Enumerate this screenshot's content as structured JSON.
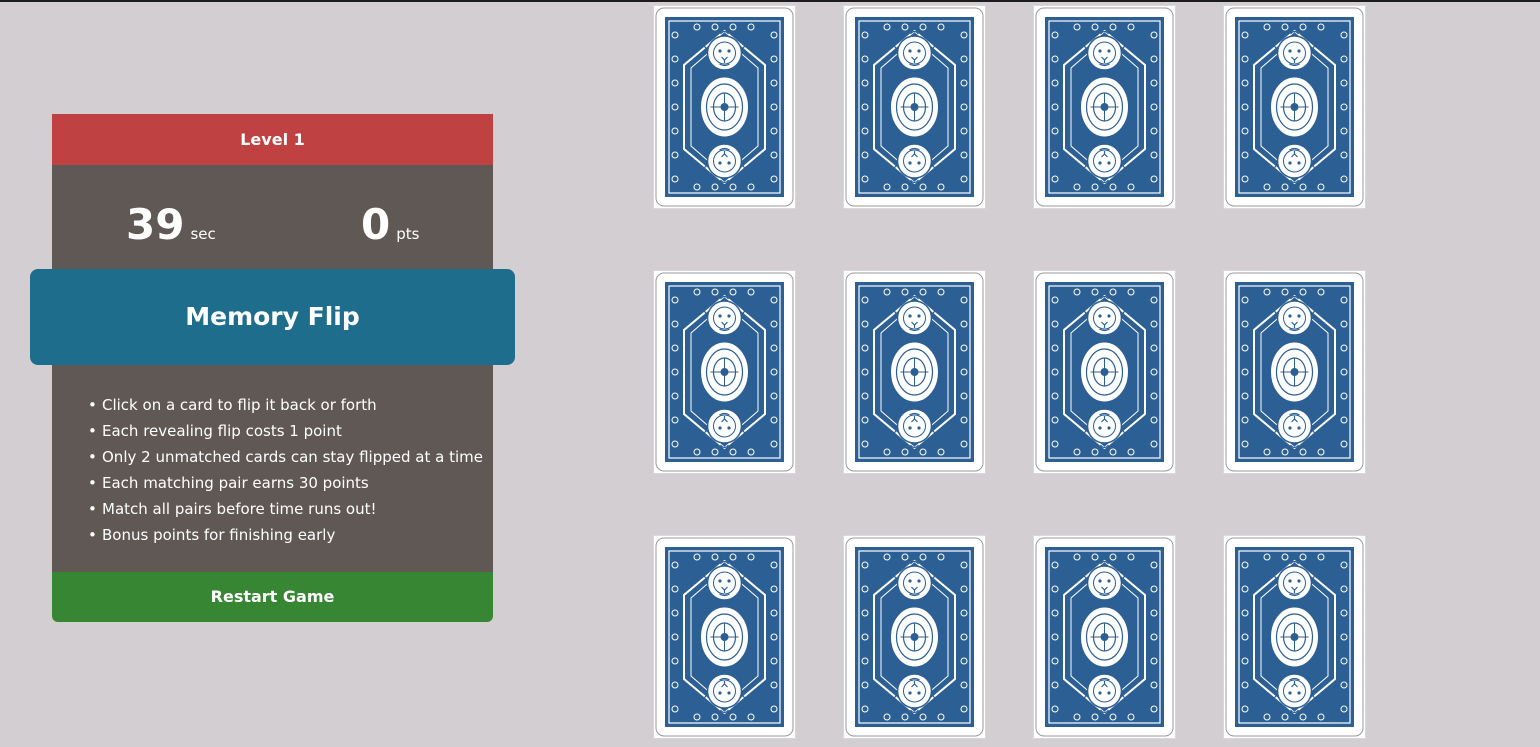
{
  "level_label": "Level 1",
  "stats": {
    "time_value": "39",
    "time_unit": "sec",
    "score_value": "0",
    "score_unit": "pts"
  },
  "title": "Memory Flip",
  "rules": [
    "Click on a card to flip it back or forth",
    "Each revealing flip costs 1 point",
    "Only 2 unmatched cards can stay flipped at a time",
    "Each matching pair earns 30 points",
    "Match all pairs before time runs out!",
    "Bonus points for finishing early"
  ],
  "restart_label": "Restart Game",
  "colors": {
    "background": "#d2ced1",
    "level_bar": "#c04141",
    "panel": "#5f5855",
    "title_bar": "#1e6d8c",
    "restart_button": "#378634",
    "card_back": "#2c5f93"
  },
  "board": {
    "rows": 3,
    "columns": 4,
    "cards": [
      {
        "face": "down",
        "icon": "lion-card-back"
      },
      {
        "face": "down",
        "icon": "lion-card-back"
      },
      {
        "face": "down",
        "icon": "lion-card-back"
      },
      {
        "face": "down",
        "icon": "lion-card-back"
      },
      {
        "face": "down",
        "icon": "lion-card-back"
      },
      {
        "face": "down",
        "icon": "lion-card-back"
      },
      {
        "face": "down",
        "icon": "lion-card-back"
      },
      {
        "face": "down",
        "icon": "lion-card-back"
      },
      {
        "face": "down",
        "icon": "lion-card-back"
      },
      {
        "face": "down",
        "icon": "lion-card-back"
      },
      {
        "face": "down",
        "icon": "lion-card-back"
      },
      {
        "face": "down",
        "icon": "lion-card-back"
      }
    ]
  }
}
